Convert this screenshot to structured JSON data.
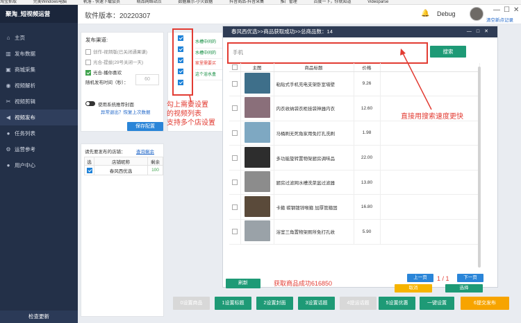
{
  "taskbar": [
    "淘宝抓取",
    "完美Windows电脑",
    "帆洛 - 快速下载会员",
    "精品网络站点",
    "数据展示-小火数据",
    "抖音商品-抖音采集",
    "推广管理",
    "百度一下，你就知道",
    "Videoparse"
  ],
  "app": {
    "title": "聚淘_短视频运营",
    "version": "软件版本：20220307",
    "debug": "Debug",
    "clear_link": "清空新点记录",
    "check_update": "检查更新"
  },
  "nav": [
    {
      "icon": "⌂",
      "label": "主页"
    },
    {
      "icon": "▥",
      "label": "发布数据"
    },
    {
      "icon": "▣",
      "label": "商城采集"
    },
    {
      "icon": "◉",
      "label": "视频解析"
    },
    {
      "icon": "✂",
      "label": "视频剪辑"
    },
    {
      "icon": "◀",
      "label": "视频发布"
    },
    {
      "icon": "●",
      "label": "任务列表"
    },
    {
      "icon": "⚙",
      "label": "运营参考"
    },
    {
      "icon": "●",
      "label": "用户中心"
    }
  ],
  "publish": {
    "title": "发布渠道:",
    "opt1": "创作-视频版(已关闭通果谦)",
    "opt2": "光合-提拔(29号关闭一天)",
    "opt3": "光合-播你喜欢",
    "interval_label": "随机发布时间（秒）：",
    "interval_value": "60",
    "recommend_label": "使用系统推荐封面",
    "abnormal_link": "异常退出？恢复上次数据",
    "save_button": "保存配置"
  },
  "shops": {
    "title": "请先要发布的店铺：",
    "refresh": "查询剩余",
    "headers": [
      "选",
      "店铺昵称",
      "剩余"
    ],
    "rows": [
      {
        "name": "春风西优选",
        "remaining": "100"
      }
    ]
  },
  "video_list": [
    "水槽中间的",
    "水槽中间的",
    "家里需要买",
    "这个浴水盒"
  ],
  "annotations": {
    "pick": "勾上需要设置\n的视频列表\n支持多个店设置",
    "search": "直接用搜索速度更快",
    "count": "获取商品成功616850"
  },
  "modal": {
    "title": "春风西优选>>商品获取成功>>总商品数：14",
    "search_placeholder": "手机",
    "search_button": "搜索",
    "headers": [
      "",
      "主图",
      "商品标题",
      "价格"
    ],
    "products": [
      {
        "title": "粘贴式手机充电支架卧室墙壁",
        "price": "9.26",
        "color": "#3e6f8a"
      },
      {
        "title": "内衣收纳袋衣柜挂袋神器内衣",
        "price": "12.60",
        "color": "#8a6f7a"
      },
      {
        "title": "马桶刷无死角家用免打孔洗刷",
        "price": "1.98",
        "color": "#7ea8c2"
      },
      {
        "title": "多功能旋转置物架厨房调味品",
        "price": "22.00",
        "color": "#2d2d2d"
      },
      {
        "title": "厨房过滤网水槽洗菜盆过滤器",
        "price": "13.80",
        "color": "#8c8c8c"
      },
      {
        "title": "卡箍 碳钢镀锌喉箍 加厚管箍固",
        "price": "16.80",
        "color": "#5a4a3a"
      },
      {
        "title": "浴室三角置物架厕所免打孔收",
        "price": "5.90",
        "color": "#9aa2a8"
      }
    ],
    "refresh_button": "刷新",
    "prev_button": "上一页",
    "next_button": "下一页",
    "page": "1 / 1",
    "cancel_button": "取消",
    "select_button": "选择"
  },
  "toolbar": [
    "0设置商品",
    "1设置标题",
    "2设置封面",
    "3设置话题",
    "4提运话题",
    "5设置优惠",
    "一键设置",
    "6提交发布"
  ]
}
